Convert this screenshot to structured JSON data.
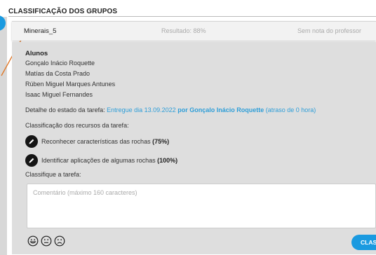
{
  "section": {
    "title": "CLASSIFICAÇÃO DOS GRUPOS"
  },
  "group": {
    "name": "Minerais_5",
    "result": "Resultado: 88%",
    "teacher_grade": "Sem nota do professor"
  },
  "students": {
    "title": "Alunos",
    "names": [
      "Gonçalo Inácio Roquette",
      "Matías da Costa Prado",
      "Rúben Miguel Marques Antunes",
      "Isaac Miguel Fernandes"
    ]
  },
  "task": {
    "label": "Detalhe do estado da tarefa:",
    "delivered": "Entregue dia 13.09.2022",
    "by": "por Gonçalo Inácio Roquette",
    "delay": "(atraso de 0 hora)"
  },
  "resources": {
    "title": "Classificação dos recursos da tarefa:",
    "items": [
      {
        "label": "Reconhecer características das rochas",
        "percent": "(75%)"
      },
      {
        "label": "Identificar aplicações de algumas rochas",
        "percent": "(100%)"
      }
    ]
  },
  "grading": {
    "title": "Classifique a tarefa:",
    "comment_placeholder": "Comentário (máximo 160 caracteres)",
    "comment_value": "",
    "faces": [
      "happy-face-icon",
      "neutral-face-icon",
      "sad-face-icon"
    ],
    "button_label": "CLAS"
  },
  "colors": {
    "accent": "#1a9ae0",
    "link": "#2e9ed8",
    "panel": "#dedede",
    "arrow": "#e07a2c"
  }
}
